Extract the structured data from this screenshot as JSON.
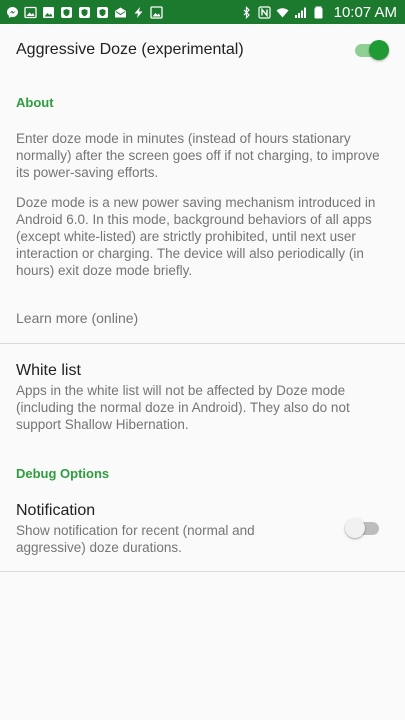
{
  "status_bar": {
    "time": "10:07 AM",
    "battery_text": "",
    "bg_color": "#1b7a2e",
    "left_icons": [
      "messenger-icon",
      "image-icon",
      "gallery-icon",
      "shield-icon",
      "shield-icon",
      "shield-icon",
      "mail-icon",
      "bolt-icon",
      "photo-icon"
    ],
    "right_icons": [
      "bluetooth-icon",
      "nfc-icon",
      "wifi-icon",
      "signal-icon",
      "battery-icon"
    ]
  },
  "prefs": {
    "aggressive_doze": {
      "title": "Aggressive Doze (experimental)",
      "enabled": true
    },
    "about_category": "About",
    "about_text_1": "Enter doze mode in minutes (instead of hours stationary normally) after the screen goes off if not charging, to improve its power-saving efforts.",
    "about_text_2": "Doze mode is a new power saving mechanism introduced in Android 6.0. In this mode, background behaviors of all apps (except white-listed) are strictly prohibited, until next user interaction or charging. The device will also periodically (in hours) exit doze mode briefly.",
    "learn_more": "Learn more (online)",
    "white_list": {
      "title": "White list",
      "summary": "Apps in the white list will not be affected by Doze mode (including the normal doze in Android). They also do not support Shallow Hibernation."
    },
    "debug_category": "Debug Options",
    "notification": {
      "title": "Notification",
      "summary": "Show notification for recent (normal and aggressive) doze durations.",
      "enabled": false
    }
  },
  "colors": {
    "accent": "#2e9d3f",
    "switch_on": "#1f9a35"
  }
}
